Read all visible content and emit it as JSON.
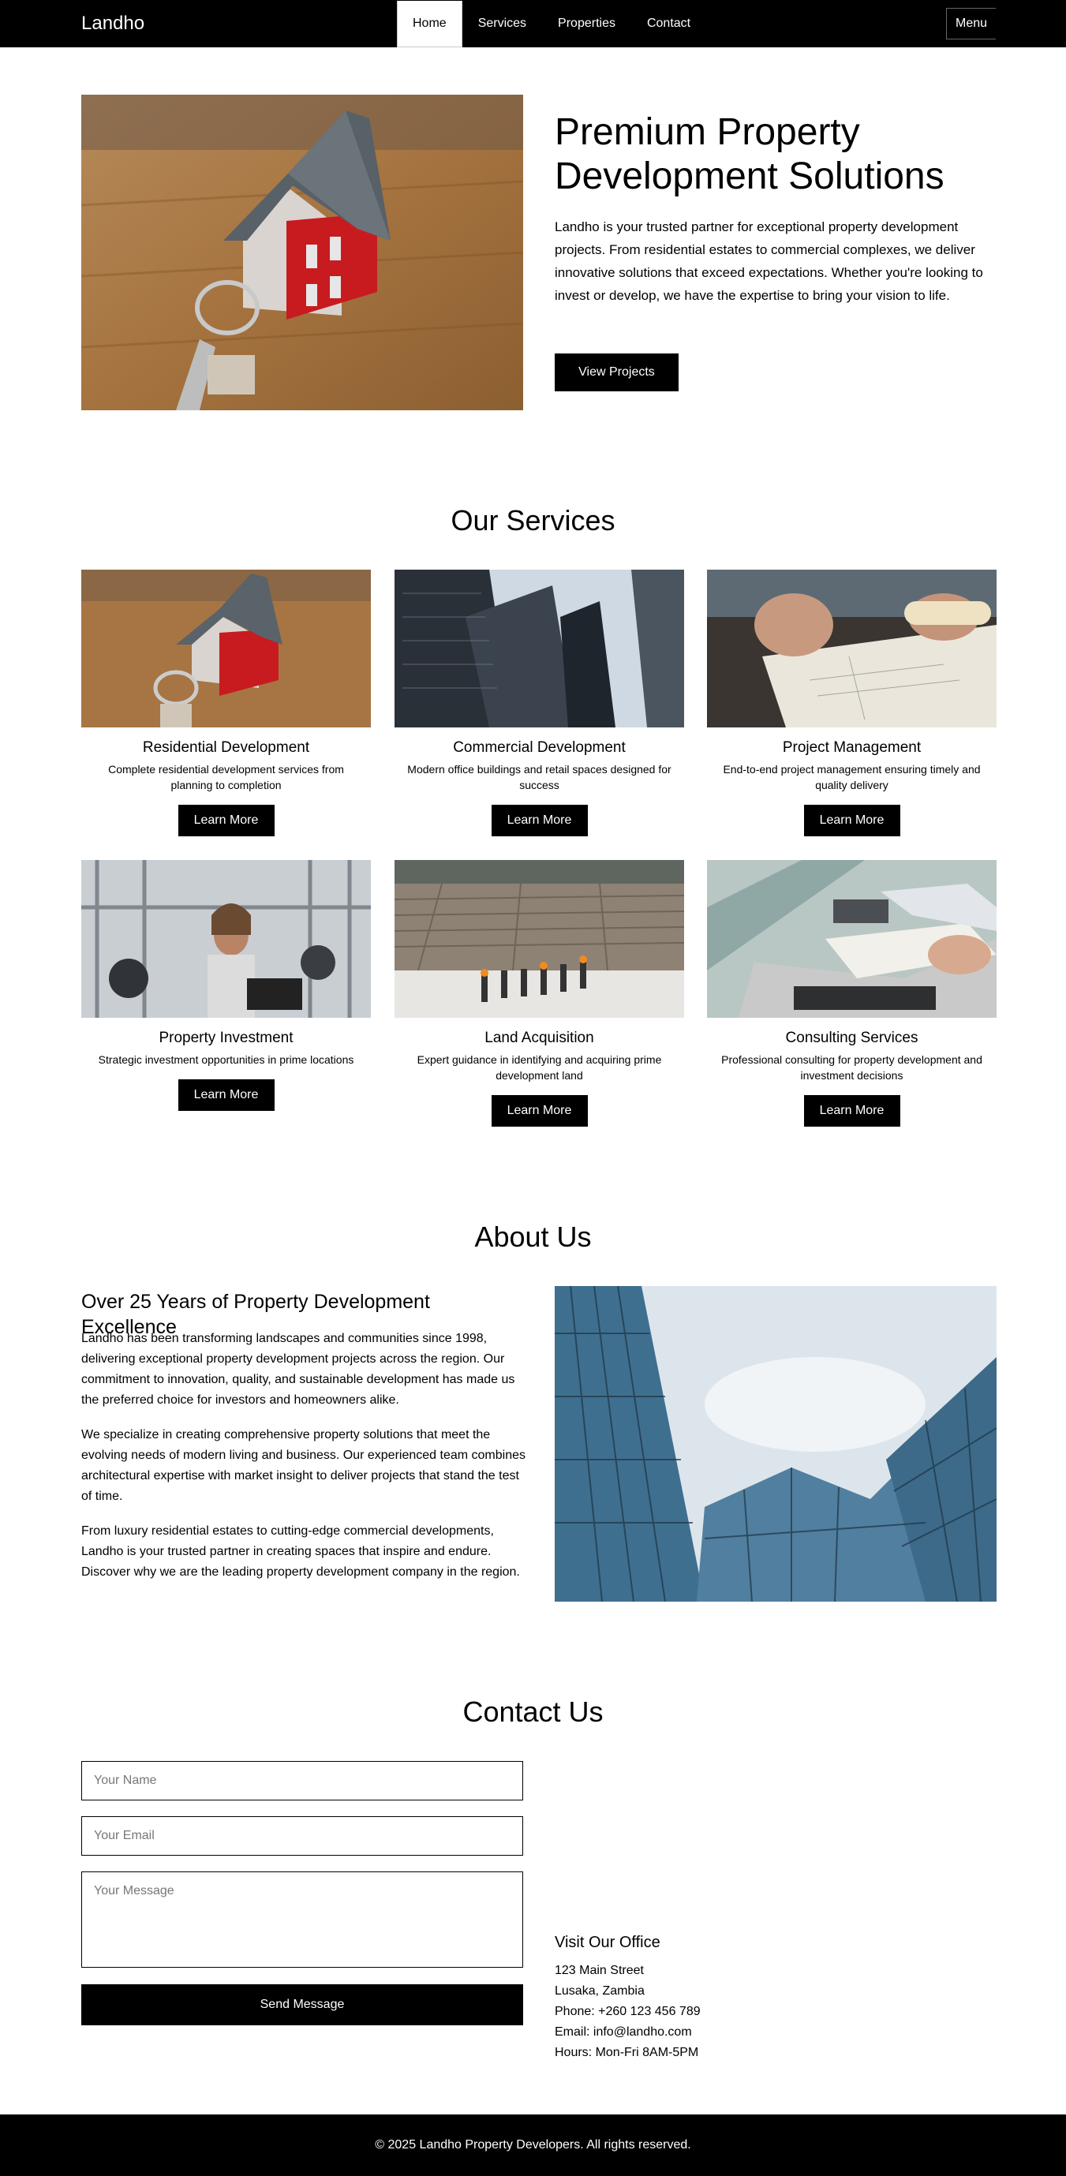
{
  "nav": {
    "brand": "Landho",
    "links": [
      {
        "label": "Home"
      },
      {
        "label": "Services"
      },
      {
        "label": "Properties"
      },
      {
        "label": "Contact"
      }
    ],
    "menu_label": "Menu"
  },
  "hero": {
    "title": "Premium Property Development Solutions",
    "text": "Landho is your trusted partner for exceptional property development projects. From residential estates to commercial complexes, we deliver innovative solutions that exceed expectations. Whether you're looking to invest or develop, we have the expertise to bring your vision to life.",
    "button": "View Projects"
  },
  "services": {
    "title": "Our Services",
    "items": [
      {
        "title": "Residential Development",
        "desc": "Complete residential development services from planning to completion",
        "button": "Learn More"
      },
      {
        "title": "Commercial Development",
        "desc": "Modern office buildings and retail spaces designed for success",
        "button": "Learn More"
      },
      {
        "title": "Project Management",
        "desc": "End-to-end project management ensuring timely and quality delivery",
        "button": "Learn More"
      },
      {
        "title": "Property Investment",
        "desc": "Strategic investment opportunities in prime locations",
        "button": "Learn More"
      },
      {
        "title": "Land Acquisition",
        "desc": "Expert guidance in identifying and acquiring prime development land",
        "button": "Learn More"
      },
      {
        "title": "Consulting Services",
        "desc": "Professional consulting for property development and investment decisions",
        "button": "Learn More"
      }
    ]
  },
  "about": {
    "title": "About Us",
    "subtitle": "Over 25 Years of Property Development Excellence",
    "paragraphs": [
      "Landho has been transforming landscapes and communities since 1998, delivering exceptional property development projects across the region. Our commitment to innovation, quality, and sustainable development has made us the preferred choice for investors and homeowners alike.",
      "We specialize in creating comprehensive property solutions that meet the evolving needs of modern living and business. Our experienced team combines architectural expertise with market insight to deliver projects that stand the test of time.",
      "From luxury residential estates to cutting-edge commercial developments, Landho is your trusted partner in creating spaces that inspire and endure. Discover why we are the leading property development company in the region."
    ]
  },
  "contact": {
    "title": "Contact Us",
    "name_placeholder": "Your Name",
    "email_placeholder": "Your Email",
    "message_placeholder": "Your Message",
    "send_button": "Send Message",
    "office": {
      "title": "Visit Our Office",
      "address1": "123 Main Street",
      "address2": "Lusaka, Zambia",
      "phone": "Phone: +260 123 456 789",
      "email": "Email: info@landho.com",
      "hours": "Hours: Mon-Fri 8AM-5PM"
    }
  },
  "footer": {
    "text": "© 2025 Landho Property Developers. All rights reserved."
  }
}
